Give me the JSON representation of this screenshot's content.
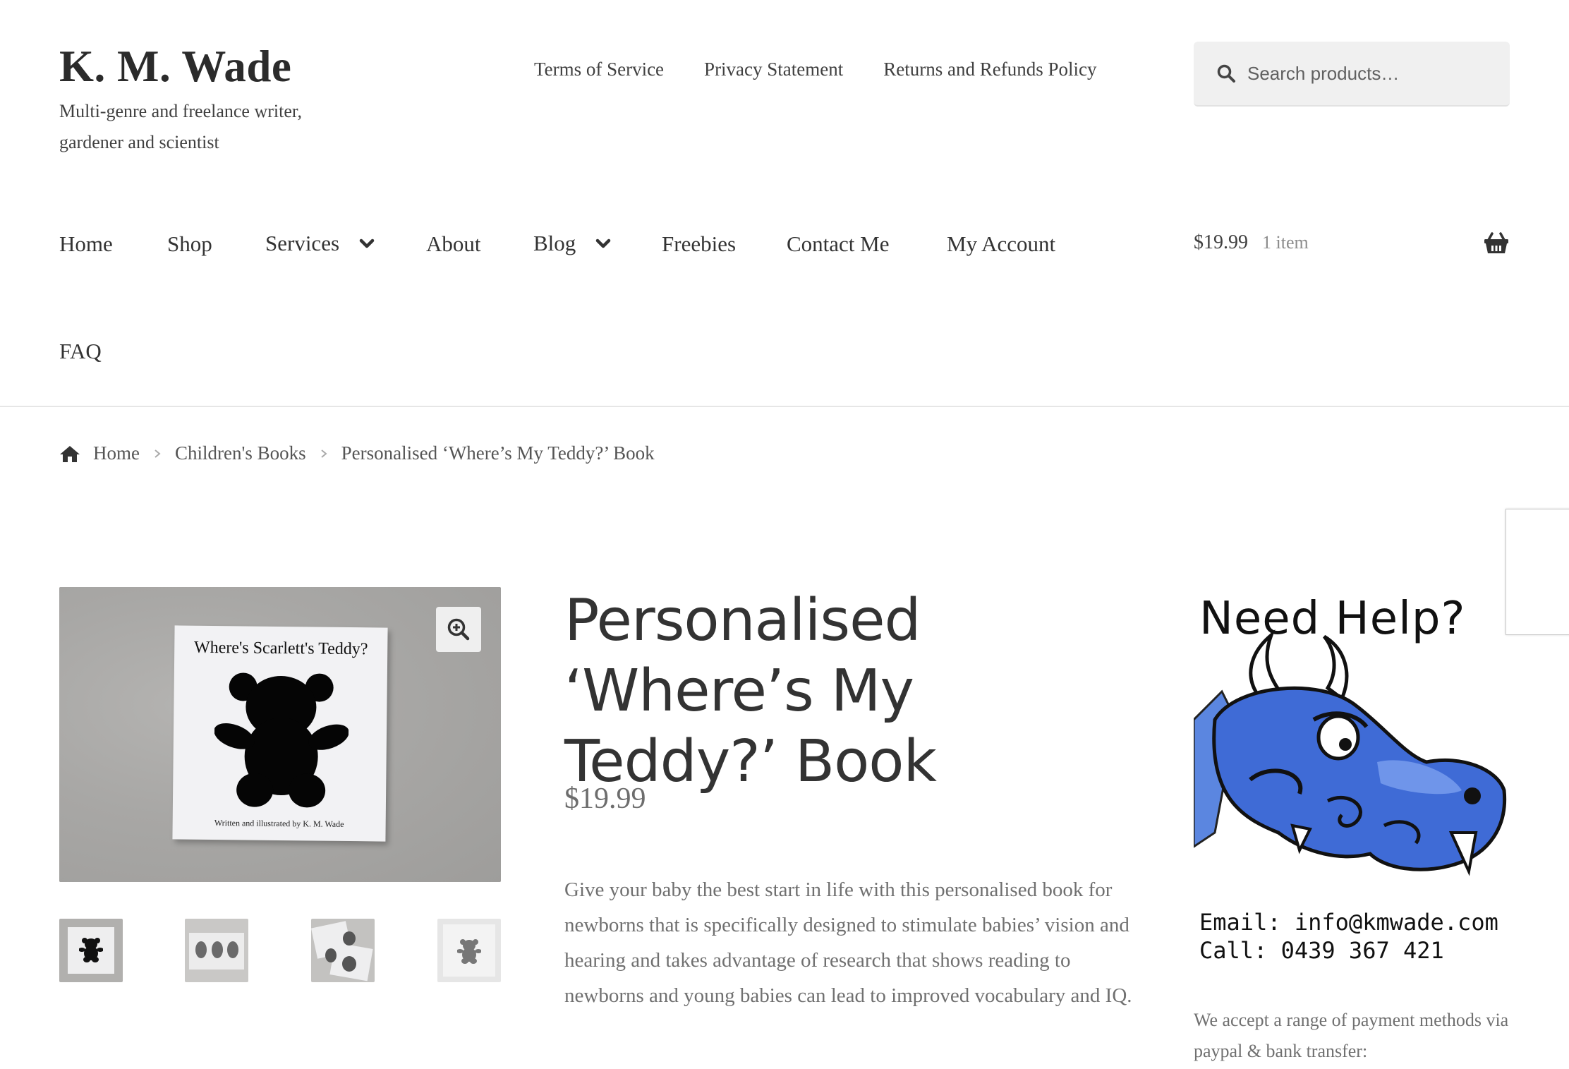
{
  "site": {
    "title": "K. M. Wade",
    "tagline": "Multi-genre and freelance writer, gardener and scientist"
  },
  "top_links": [
    "Terms of Service",
    "Privacy Statement",
    "Returns and Refunds Policy"
  ],
  "search": {
    "placeholder": "Search products…",
    "icon": "search-icon"
  },
  "nav": {
    "home": "Home",
    "shop": "Shop",
    "services": "Services",
    "about": "About",
    "blog": "Blog",
    "freebies": "Freebies",
    "contact": "Contact Me",
    "account": "My Account",
    "faq": "FAQ"
  },
  "cart": {
    "amount": "$19.99",
    "count": "1 item",
    "icon": "basket-icon"
  },
  "breadcrumb": {
    "home": "Home",
    "category": "Children's Books",
    "current": "Personalised ‘Where’s My Teddy?’ Book"
  },
  "product": {
    "title": "Personalised ‘Where’s My Teddy?’ Book",
    "price": "$19.99",
    "description": "Give your baby the best start in life with this personalised book for newborns that is specifically designed to stimulate babies’ vision and hearing and takes advantage of research that shows reading to newborns and young babies can lead to improved vocabulary and IQ.",
    "image": {
      "book_title": "Where's Scarlett's Teddy?",
      "book_author": "Written and illustrated by K. M. Wade"
    },
    "thumbnail_count": 4
  },
  "help": {
    "heading": "Need Help?",
    "email": "Email: info@kmwade.com",
    "phone": "Call: 0439 367 421"
  },
  "payment_text": "We accept a range of payment methods via paypal & bank transfer:",
  "colors": {
    "text": "#333333",
    "muted": "#707070",
    "search_bg": "#f0f0f0",
    "dragon_blue": "#3f6bd6"
  }
}
